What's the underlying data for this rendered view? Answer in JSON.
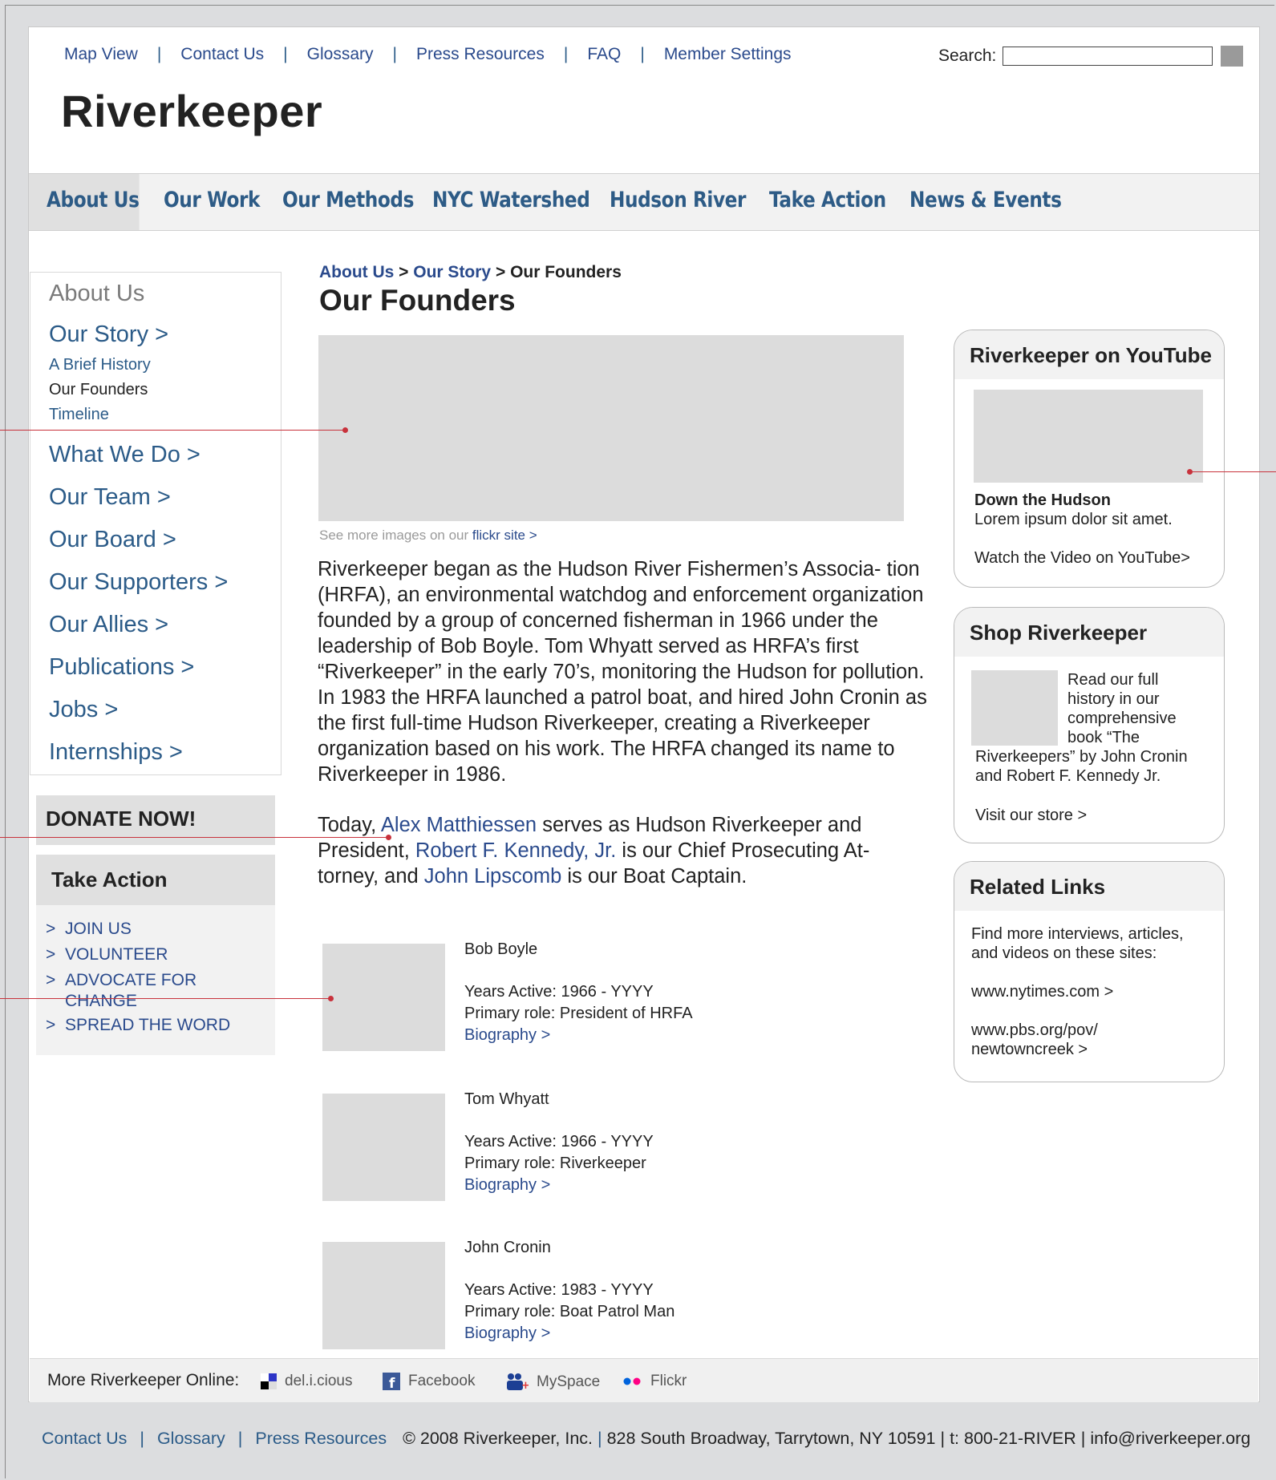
{
  "topnav": {
    "links": [
      "Map View",
      "Contact Us",
      "Glossary",
      "Press Resources",
      "FAQ",
      "Member Settings"
    ],
    "separator": "|"
  },
  "search": {
    "label": "Search:",
    "value": ""
  },
  "logo": "Riverkeeper",
  "mainnav": [
    "About Us",
    "Our Work",
    "Our Methods",
    "NYC Watershed",
    "Hudson River",
    "Take Action",
    "News & Events"
  ],
  "leftnav": {
    "header": "About Us",
    "story": "Our Story >",
    "sub": [
      "A Brief History",
      "Our Founders",
      "Timeline"
    ],
    "items": [
      "What We Do >",
      "Our Team >",
      "Our Board >",
      "Our Supporters >",
      "Our Allies >",
      "Publications >",
      "Jobs >",
      "Internships >"
    ]
  },
  "donate": "DONATE NOW!",
  "take_action": {
    "title": "Take Action",
    "arrow": ">",
    "items": [
      "JOIN US",
      "VOLUNTEER",
      "ADVOCATE FOR CHANGE",
      "SPREAD THE WORD"
    ]
  },
  "breadcrumb": {
    "l1": "About Us",
    "sep": " > ",
    "l2": "Our Story",
    "current": "Our Founders"
  },
  "page_title": "Our Founders",
  "caption": {
    "text": "See more images on our ",
    "link": "flickr site >"
  },
  "body1": "Riverkeeper began as the Hudson River Fishermen’s Associa- tion (HRFA), an environmental watchdog and enforcement organization founded by a group of concerned fisherman in 1966 under the leadership of Bob Boyle. Tom Whyatt served as HRFA’s first “Riverkeeper” in the early 70’s, monitoring the Hudson for pollution. In 1983 the HRFA launched a patrol boat, and hired John Cronin as the first full-time Hudson Riverkeeper, creating a Riverkeeper organization based on his work. The HRFA changed its name to Riverkeeper in 1986.",
  "body2": {
    "t1": "Today, ",
    "l1": "Alex Matthiessen",
    "t2": " serves as Hudson Riverkeeper and President, ",
    "l2": "Robert F. Kennedy, Jr.",
    "t3": " is our Chief Prosecuting At- torney, and ",
    "l3": "John Lipscomb",
    "t4": " is our Boat Captain."
  },
  "founders": [
    {
      "name": "Bob Boyle",
      "years": "Years Active: 1966 - YYYY",
      "role": "Primary role: President of HRFA",
      "bio": "Biography >"
    },
    {
      "name": "Tom Whyatt",
      "years": "Years Active: 1966 - YYYY",
      "role": "Primary role: Riverkeeper",
      "bio": "Biography >"
    },
    {
      "name": "John Cronin",
      "years": "Years Active: 1983 - YYYY",
      "role": "Primary role: Boat Patrol Man",
      "bio": "Biography >"
    }
  ],
  "youtube": {
    "title": "Riverkeeper on YouTube",
    "video_title": "Down the Hudson",
    "desc": "Lorem ipsum dolor sit amet.",
    "link": "Watch the Video on YouTube>"
  },
  "shop": {
    "title": "Shop Riverkeeper",
    "text_side": "Read our full history in our comprehensive book “The",
    "text_below": "Riverkeepers” by John Cronin and Robert F. Kennedy Jr.",
    "link": "Visit our store >"
  },
  "related": {
    "title": "Related Links",
    "intro": "Find more interviews, articles, and videos on these sites:",
    "links": [
      "www.nytimes.com >",
      "www.pbs.org/pov/ newtowncreek >"
    ]
  },
  "footer": {
    "label": "More Riverkeeper Online:",
    "social": [
      {
        "icon": "delicious-icon",
        "label": "del.i.cious"
      },
      {
        "icon": "facebook-icon",
        "label": "Facebook"
      },
      {
        "icon": "myspace-icon",
        "label": "MySpace"
      },
      {
        "icon": "flickr-icon",
        "label": "Flickr"
      }
    ]
  },
  "bottom": {
    "links": [
      "Contact Us",
      "Glossary",
      "Press Resources"
    ],
    "copyright": "© 2008 Riverkeeper, Inc.",
    "address": "828 South Broadway, Tarrytown, NY 10591",
    "phone": "t: 800-21-RIVER",
    "email": "info@riverkeeper.org"
  },
  "colors": {
    "link": "#2a4a8c",
    "nav": "#2d5b86",
    "annotation": "#c8323c",
    "placeholder": "#dcdcdc"
  }
}
